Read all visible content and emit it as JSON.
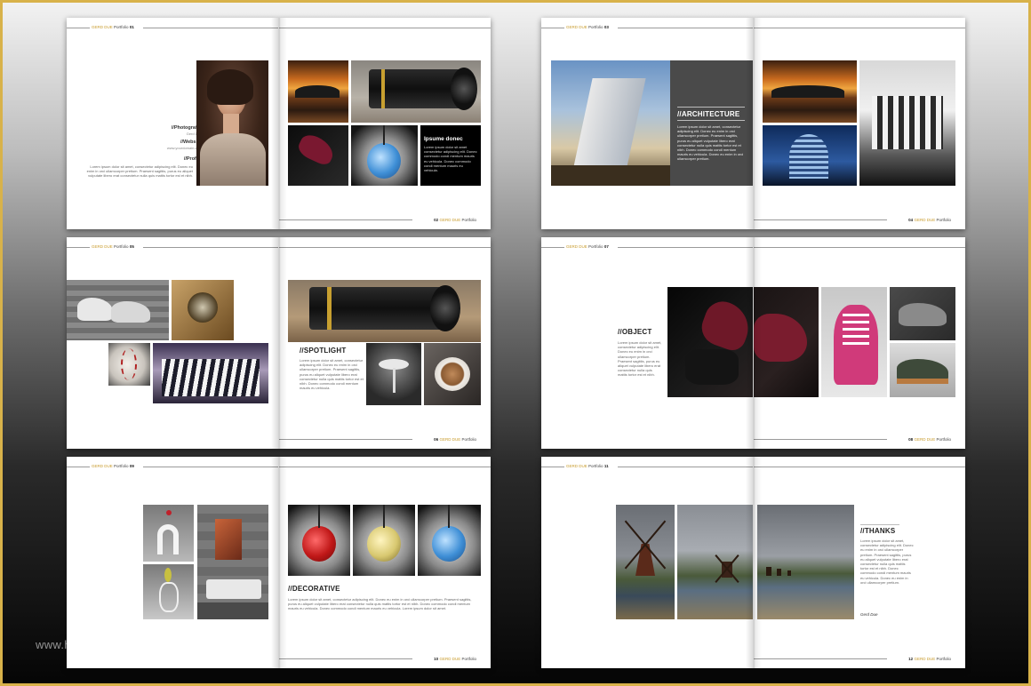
{
  "brand": "GERD DUE",
  "section": "Portfolio",
  "colors": {
    "accent": "#c89b2b",
    "frame": "#d8b24a"
  },
  "spreads": [
    {
      "left_page_no": "01",
      "right_page_no": "02",
      "photographer_label": "//Photografer",
      "photographer_name": "Gerd Due",
      "website_label": "//Website",
      "website_url": "www.yourdomain.com",
      "profile_label": "//Profile",
      "profile_text": "Lorem ipsum dolor sit amet, consectetur adipiscing elit. Donec eu enim in orci ullamcorper pretium. Praesent sagittis, purus eu aliquet vulputate libero erat consectetur nulla quis mattis tortor est et nibh.",
      "caption_title": "Ipsume donec",
      "caption_text": "Lorem ipsum dolor sit amet consectetur adipiscing elit. Donec commodo condi mentum mauris eu vehicula. Donec commodo condi mentum mauris eu vehicula."
    },
    {
      "left_page_no": "03",
      "right_page_no": "04",
      "title": "//ARCHITECTURE",
      "text": "Lorem ipsum dolor sit amet, consectetur adipiscing elit. Donec eu enim in orci ullamcorper pretium. Praesent sagittis, purus eu aliquet vulputate libero erat consectetur nulla quis mattis tortor est et nibh. Donec commodo condi mentum mauris eu vehicula. Donec eu enim in orci ullamcorper pretium."
    },
    {
      "left_page_no": "05",
      "right_page_no": "06",
      "title": "//SPOTLIGHT",
      "text": "Lorem ipsum dolor sit amet, consectetur adipiscing elit. Donec eu enim in orci ullamcorper pretium. Praesent sagittis, purus eu aliquet vulputate libero erat consectetur nulla quis mattis tortor est et nibh. Donec commodo condi mentum mauris eu vehicula."
    },
    {
      "left_page_no": "07",
      "right_page_no": "08",
      "title": "//OBJECT",
      "text": "Lorem ipsum dolor sit amet, consectetur adipiscing elit. Donec eu enim in orci ullamcorper pretium. Praesent sagittis, purus eu aliquet vulputate libero erat consectetur nulla quis mattis tortor est et nibh."
    },
    {
      "left_page_no": "09",
      "right_page_no": "10",
      "title": "//DECORATIVE",
      "text": "Lorem ipsum dolor sit amet, consectetur adipiscing elit. Donec eu enim in orci ullamcorper pretium. Praesent sagittis, purus eu aliquet vulputate libero erat consectetur nulla quis mattis tortor est et nibh. Donec commodo condi mentum mauris eu vehicula. Donec commodo condi mentum mauris eu vehicula. Lorem ipsum dolor sit amet."
    },
    {
      "left_page_no": "11",
      "right_page_no": "12",
      "title": "//THANKS",
      "text": "Lorem ipsum dolor sit amet, consectetur adipiscing elit. Donec eu enim in orci ullamcorper pretium. Praesent sagittis, purus eu aliquet vulputate libero erat consectetur nulla quis mattis tortor est et nibh. Donec commodo condi mentum mauris eu vehicula. Donec eu enim in orci ullamcorper pretium.",
      "signature": "Gerd Due"
    }
  ],
  "watermark": "www.heritagechristiancollege.com"
}
